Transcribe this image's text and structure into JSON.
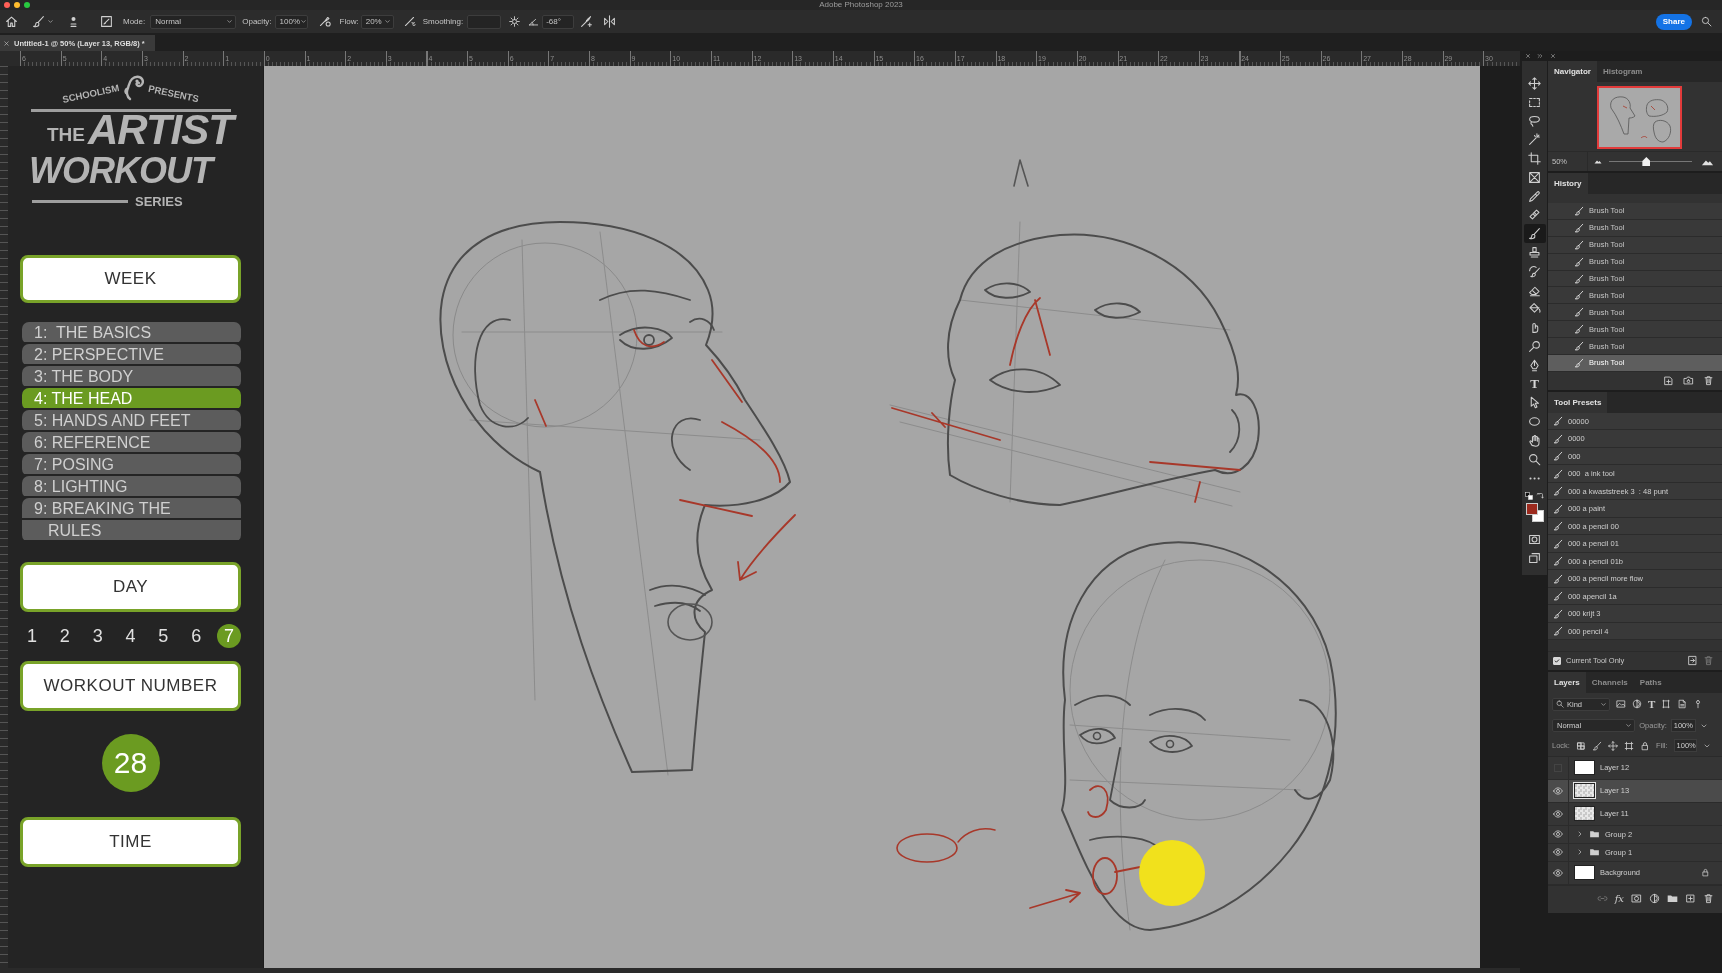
{
  "window": {
    "title": "Adobe Photoshop 2023"
  },
  "options_bar": {
    "mode": {
      "label": "Mode:",
      "value": "Normal"
    },
    "opacity": {
      "label": "Opacity:",
      "value": "100%"
    },
    "flow": {
      "label": "Flow:",
      "value": "20%"
    },
    "smoothing": {
      "label": "Smoothing:"
    },
    "angle": {
      "value": "-68°"
    },
    "share_button": "Share"
  },
  "document_tab": {
    "title": "Untitled-1 @ 50% (Layer 13, RGB/8) *"
  },
  "ruler": {
    "labels": [
      "6",
      "5",
      "4",
      "3",
      "2",
      "1",
      "0",
      "1",
      "2",
      "3",
      "4",
      "5",
      "6",
      "7",
      "8",
      "9",
      "10",
      "11",
      "12",
      "13",
      "14",
      "15",
      "16",
      "17",
      "18",
      "19",
      "20",
      "21",
      "22",
      "23",
      "24",
      "25",
      "26",
      "27",
      "28",
      "29",
      "30"
    ]
  },
  "overlay": {
    "logo": {
      "top_left": "SCHOOLISM",
      "top_right": "PRESENTS",
      "line_1": "THE",
      "line_2": "ARTIST",
      "line_3": "WORKOUT",
      "line_4": "SERIES"
    },
    "week_heading": "WEEK",
    "weeks": [
      {
        "label": "1:  THE BASICS",
        "selected": false
      },
      {
        "label": "2: PERSPECTIVE",
        "selected": false
      },
      {
        "label": "3: THE BODY",
        "selected": false
      },
      {
        "label": "4: THE HEAD",
        "selected": true
      },
      {
        "label": "5: HANDS AND FEET",
        "selected": false
      },
      {
        "label": "6: REFERENCE",
        "selected": false
      },
      {
        "label": "7: POSING",
        "selected": false
      },
      {
        "label": "8: LIGHTING",
        "selected": false
      },
      {
        "label": "9: BREAKING THE RULES",
        "selected": false
      }
    ],
    "day_heading": "DAY",
    "days": [
      {
        "label": "1",
        "selected": false
      },
      {
        "label": "2",
        "selected": false
      },
      {
        "label": "3",
        "selected": false
      },
      {
        "label": "4",
        "selected": false
      },
      {
        "label": "5",
        "selected": false
      },
      {
        "label": "6",
        "selected": false
      },
      {
        "label": "7",
        "selected": true
      }
    ],
    "workout_heading": "WORKOUT NUMBER",
    "workout_number": "28",
    "time_heading": "TIME"
  },
  "tools": [
    {
      "kind": "move",
      "selected": false
    },
    {
      "kind": "marquee",
      "selected": false
    },
    {
      "kind": "lasso",
      "selected": false
    },
    {
      "kind": "magic_wand",
      "selected": false
    },
    {
      "kind": "crop",
      "selected": false
    },
    {
      "kind": "frame",
      "selected": false
    },
    {
      "kind": "eyedropper",
      "selected": false
    },
    {
      "kind": "healing",
      "selected": false
    },
    {
      "kind": "brush",
      "selected": true
    },
    {
      "kind": "stamp",
      "selected": false
    },
    {
      "kind": "history_brush",
      "selected": false
    },
    {
      "kind": "eraser",
      "selected": false
    },
    {
      "kind": "bucket",
      "selected": false
    },
    {
      "kind": "smudge",
      "selected": false
    },
    {
      "kind": "dodge",
      "selected": false
    },
    {
      "kind": "pen",
      "selected": false
    },
    {
      "kind": "type",
      "glyph": "T",
      "selected": false
    },
    {
      "kind": "path_select",
      "selected": false
    },
    {
      "kind": "ellipse",
      "selected": false
    },
    {
      "kind": "hand",
      "selected": false
    },
    {
      "kind": "zoom",
      "selected": false
    },
    {
      "kind": "more",
      "selected": false
    }
  ],
  "colors": [
    {
      "kind": "foreground",
      "color": "#9c2a1e"
    },
    {
      "kind": "background",
      "color": "#ffffff"
    }
  ],
  "navigator": {
    "tabs": [
      {
        "label": "Navigator",
        "selected": true
      },
      {
        "label": "Histogram",
        "selected": false
      }
    ],
    "zoom": "50%",
    "zoom_slider": {
      "level": 0.45
    }
  },
  "history": {
    "title": "History",
    "items": [
      {
        "label": "Brush Tool",
        "selected": false
      },
      {
        "label": "Brush Tool",
        "selected": false
      },
      {
        "label": "Brush Tool",
        "selected": false
      },
      {
        "label": "Brush Tool",
        "selected": false
      },
      {
        "label": "Brush Tool",
        "selected": false
      },
      {
        "label": "Brush Tool",
        "selected": false
      },
      {
        "label": "Brush Tool",
        "selected": false
      },
      {
        "label": "Brush Tool",
        "selected": false
      },
      {
        "label": "Brush Tool",
        "selected": false
      },
      {
        "label": "Brush Tool",
        "selected": true
      }
    ]
  },
  "tool_presets": {
    "title": "Tool Presets",
    "items": [
      "00000",
      "0000",
      "000",
      "000  a ink tool",
      "000 a kwaststreek 3  : 48 punt",
      "000 a paint",
      "000 a pencil 00",
      "000 a pencil 01",
      "000 a pencil 01b",
      "000 a pencil more flow",
      "000 apencil 1a",
      "000 krijt 3",
      "000 pencil 4"
    ],
    "current_tool_only": {
      "label": "Current Tool Only",
      "checked": true
    }
  },
  "layers": {
    "tabs": [
      {
        "label": "Layers",
        "selected": true
      },
      {
        "label": "Channels",
        "selected": false
      },
      {
        "label": "Paths",
        "selected": false
      }
    ],
    "filter": "Kind",
    "filter_type_glyph": "T",
    "blend_mode": "Normal",
    "opacity": {
      "label": "Opacity:",
      "value": "100%"
    },
    "lock_label": "Lock:",
    "fill": {
      "label": "Fill:",
      "value": "100%"
    },
    "items": [
      {
        "name": "Layer 12",
        "kind": "layer",
        "thumbnail_transparent": false,
        "visible": false,
        "selected": false,
        "locked": false
      },
      {
        "name": "Layer 13",
        "kind": "layer",
        "thumbnail_transparent": true,
        "visible": true,
        "selected": true,
        "locked": false
      },
      {
        "name": "Layer 11",
        "kind": "layer",
        "thumbnail_transparent": true,
        "visible": true,
        "selected": false,
        "locked": false
      },
      {
        "name": "Group 2",
        "kind": "group",
        "expanded": false,
        "visible": true,
        "selected": false,
        "locked": false
      },
      {
        "name": "Group 1",
        "kind": "group",
        "expanded": false,
        "visible": true,
        "selected": false,
        "locked": false
      },
      {
        "name": "Background",
        "kind": "layer",
        "thumbnail_transparent": false,
        "visible": true,
        "selected": false,
        "locked": true
      }
    ],
    "fx_glyph": "fx"
  }
}
